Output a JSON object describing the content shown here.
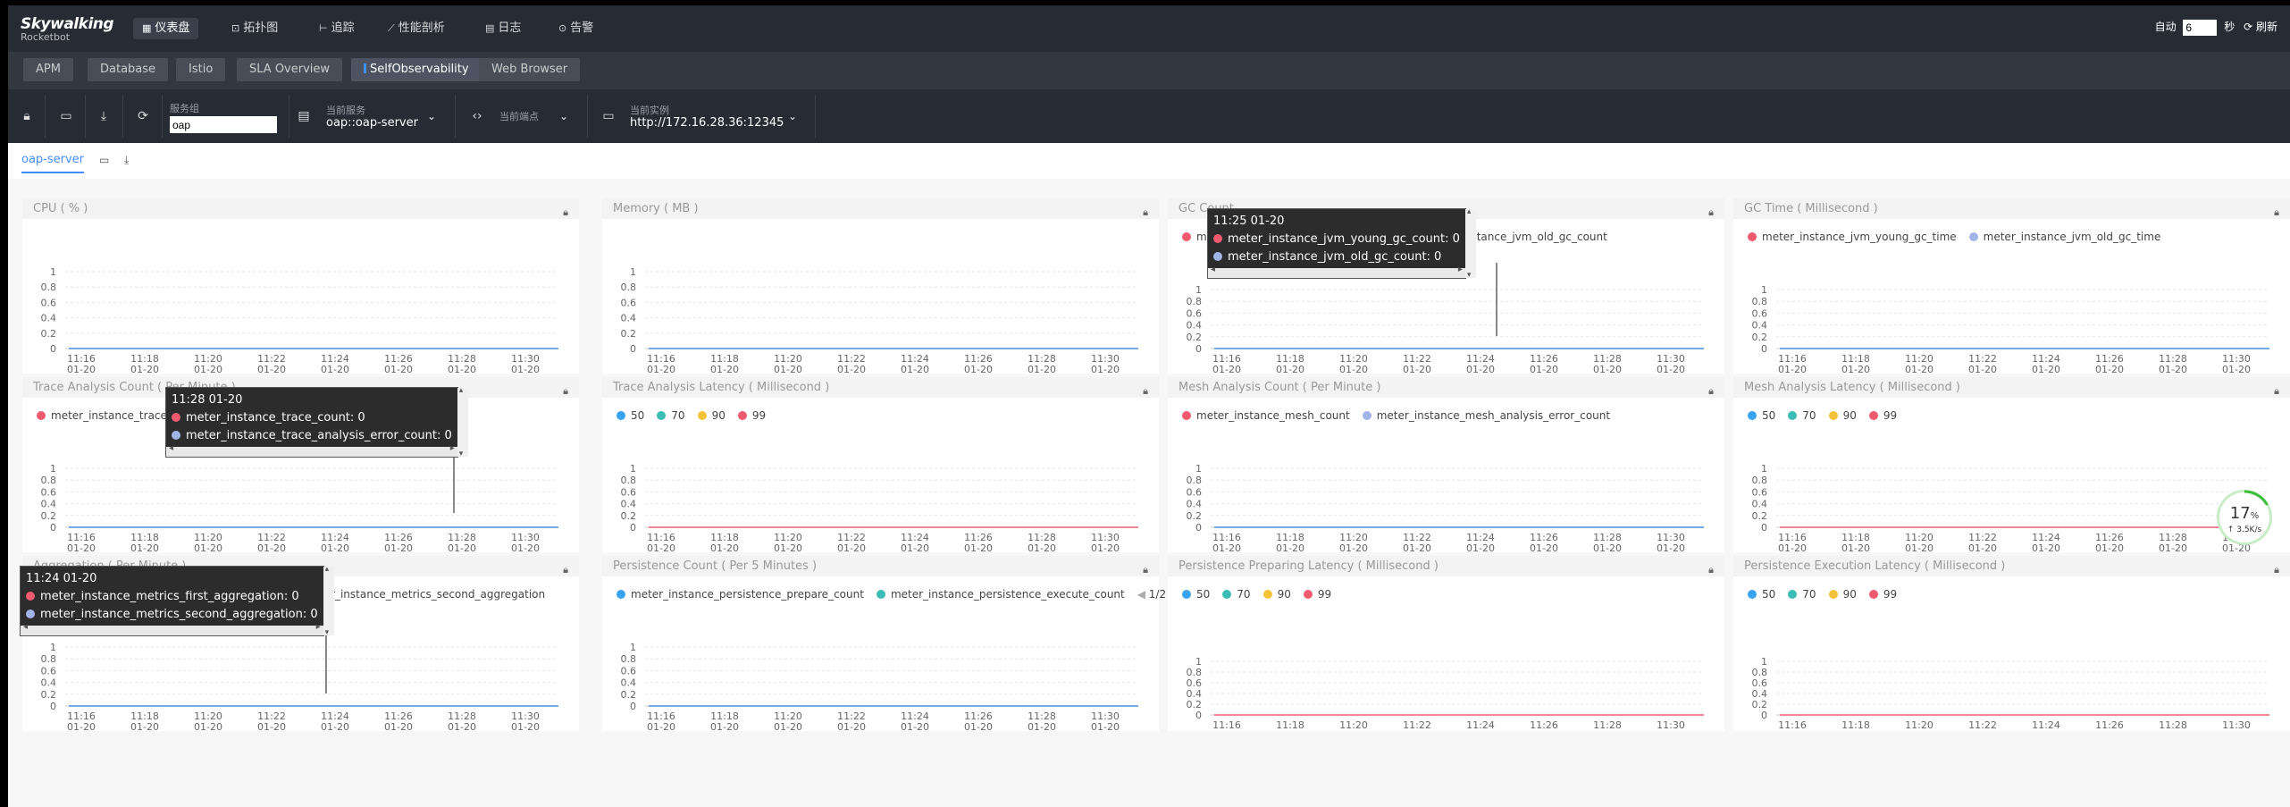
{
  "app": {
    "logo_line1": "Skywalking",
    "logo_line2": "Rocketbot"
  },
  "nav": {
    "items": [
      {
        "label": "仪表盘",
        "icon": "dashboard-icon",
        "active": true
      },
      {
        "label": "拓扑图",
        "icon": "topology-icon",
        "active": false
      },
      {
        "label": "追踪",
        "icon": "trace-icon",
        "active": false
      },
      {
        "label": "性能剖析",
        "icon": "profile-icon",
        "active": false
      },
      {
        "label": "日志",
        "icon": "log-icon",
        "active": false
      },
      {
        "label": "告警",
        "icon": "alarm-icon",
        "active": false
      }
    ],
    "auto_label": "自动",
    "interval_value": "6",
    "seconds_label": "秒",
    "refresh_label": "刷新"
  },
  "tabs": [
    {
      "label": "APM"
    },
    {
      "label": "Database"
    },
    {
      "label": "Istio"
    },
    {
      "label": "SLA Overview"
    },
    {
      "label": "SelfObservability"
    },
    {
      "label": "Web Browser"
    }
  ],
  "toolbar": {
    "service_group_label": "服务组",
    "service_group_value": "oap",
    "service_label": "当前服务",
    "service_value": "oap::oap-server",
    "endpoint_label": "当前端点",
    "instance_label": "当前实例",
    "instance_value": "http://172.16.28.36:12345"
  },
  "subbar": {
    "tab_label": "oap-server"
  },
  "time_axis": {
    "ticks": [
      "11:16",
      "11:18",
      "11:20",
      "11:22",
      "11:24",
      "11:26",
      "11:28",
      "11:30"
    ],
    "date": "01-20"
  },
  "y_axis": [
    "1",
    "0.8",
    "0.6",
    "0.4",
    "0.2",
    "0"
  ],
  "colors": {
    "red": "#ef5b6e",
    "blue": "#a3b4e8",
    "teal": "#3bbcb4",
    "sky": "#3aa3ee",
    "yellow": "#f5c23a",
    "line_blue": "#4a90d8",
    "line_red": "#ef5b6e"
  },
  "cards": [
    {
      "title": "CPU ( % )",
      "legend": [],
      "line_color": "blue"
    },
    {
      "title": "Memory ( MB )",
      "legend": [],
      "line_color": "blue"
    },
    {
      "title": "GC Count",
      "legend": [
        {
          "label": "meter_instance_jvm_young_gc_count",
          "color": "red"
        },
        {
          "label": "meter_instance_jvm_old_gc_count",
          "color": "blue"
        }
      ],
      "line_color": "blue"
    },
    {
      "title": "GC Time ( Millisecond )",
      "legend": [
        {
          "label": "meter_instance_jvm_young_gc_time",
          "color": "red"
        },
        {
          "label": "meter_instance_jvm_old_gc_time",
          "color": "blue"
        }
      ],
      "line_color": "blue"
    },
    {
      "title": "Trace Analysis Count ( Per Minute )",
      "legend": [
        {
          "label": "meter_instance_trace_count",
          "color": "red"
        },
        {
          "label": "meter_instance_trace_analysis_error_count",
          "color": "blue"
        }
      ],
      "line_color": "blue"
    },
    {
      "title": "Trace Analysis Latency ( Millisecond )",
      "legend": [
        {
          "label": "50",
          "color": "sky"
        },
        {
          "label": "70",
          "color": "teal"
        },
        {
          "label": "90",
          "color": "yellow"
        },
        {
          "label": "99",
          "color": "red"
        }
      ],
      "line_color": "red"
    },
    {
      "title": "Mesh Analysis Count ( Per Minute )",
      "legend": [
        {
          "label": "meter_instance_mesh_count",
          "color": "red"
        },
        {
          "label": "meter_instance_mesh_analysis_error_count",
          "color": "blue"
        }
      ],
      "line_color": "blue"
    },
    {
      "title": "Mesh Analysis Latency ( Millisecond )",
      "legend": [
        {
          "label": "50",
          "color": "sky"
        },
        {
          "label": "70",
          "color": "teal"
        },
        {
          "label": "90",
          "color": "yellow"
        },
        {
          "label": "99",
          "color": "red"
        }
      ],
      "line_color": "red"
    },
    {
      "title": "Aggregation ( Per Minute )",
      "legend": [
        {
          "label": "meter_instance_metrics_first_aggregation",
          "color": "red"
        },
        {
          "label": "meter_instance_metrics_second_aggregation",
          "color": "blue"
        }
      ],
      "line_color": "blue"
    },
    {
      "title": "Persistence Count ( Per 5 Minutes )",
      "legend": [
        {
          "label": "meter_instance_persistence_prepare_count",
          "color": "sky"
        },
        {
          "label": "meter_instance_persistence_execute_count",
          "color": "teal"
        }
      ],
      "line_color": "blue",
      "pager": "1/2"
    },
    {
      "title": "Persistence Preparing Latency ( Millisecond )",
      "legend": [
        {
          "label": "50",
          "color": "sky"
        },
        {
          "label": "70",
          "color": "teal"
        },
        {
          "label": "90",
          "color": "yellow"
        },
        {
          "label": "99",
          "color": "red"
        }
      ],
      "line_color": "red"
    },
    {
      "title": "Persistence Execution Latency ( Millisecond )",
      "legend": [
        {
          "label": "50",
          "color": "sky"
        },
        {
          "label": "70",
          "color": "teal"
        },
        {
          "label": "90",
          "color": "yellow"
        },
        {
          "label": "99",
          "color": "red"
        }
      ],
      "line_color": "red"
    }
  ],
  "tooltips": [
    {
      "time": "11:25 01-20",
      "rows": [
        {
          "text": "meter_instance_jvm_young_gc_count: 0",
          "color": "red"
        },
        {
          "text": "meter_instance_jvm_old_gc_count: 0",
          "color": "blue"
        }
      ]
    },
    {
      "time": "11:28 01-20",
      "rows": [
        {
          "text": "meter_instance_trace_count: 0",
          "color": "red"
        },
        {
          "text": "meter_instance_trace_analysis_error_count: 0",
          "color": "blue"
        }
      ]
    },
    {
      "time": "11:24 01-20",
      "rows": [
        {
          "text": "meter_instance_metrics_first_aggregation: 0",
          "color": "red"
        },
        {
          "text": "meter_instance_metrics_second_aggregation: 0",
          "color": "blue"
        }
      ]
    }
  ],
  "network_gauge": {
    "percent": "17",
    "unit": "%",
    "speed": "↑ 3.5K/s",
    "level": 0.17
  }
}
